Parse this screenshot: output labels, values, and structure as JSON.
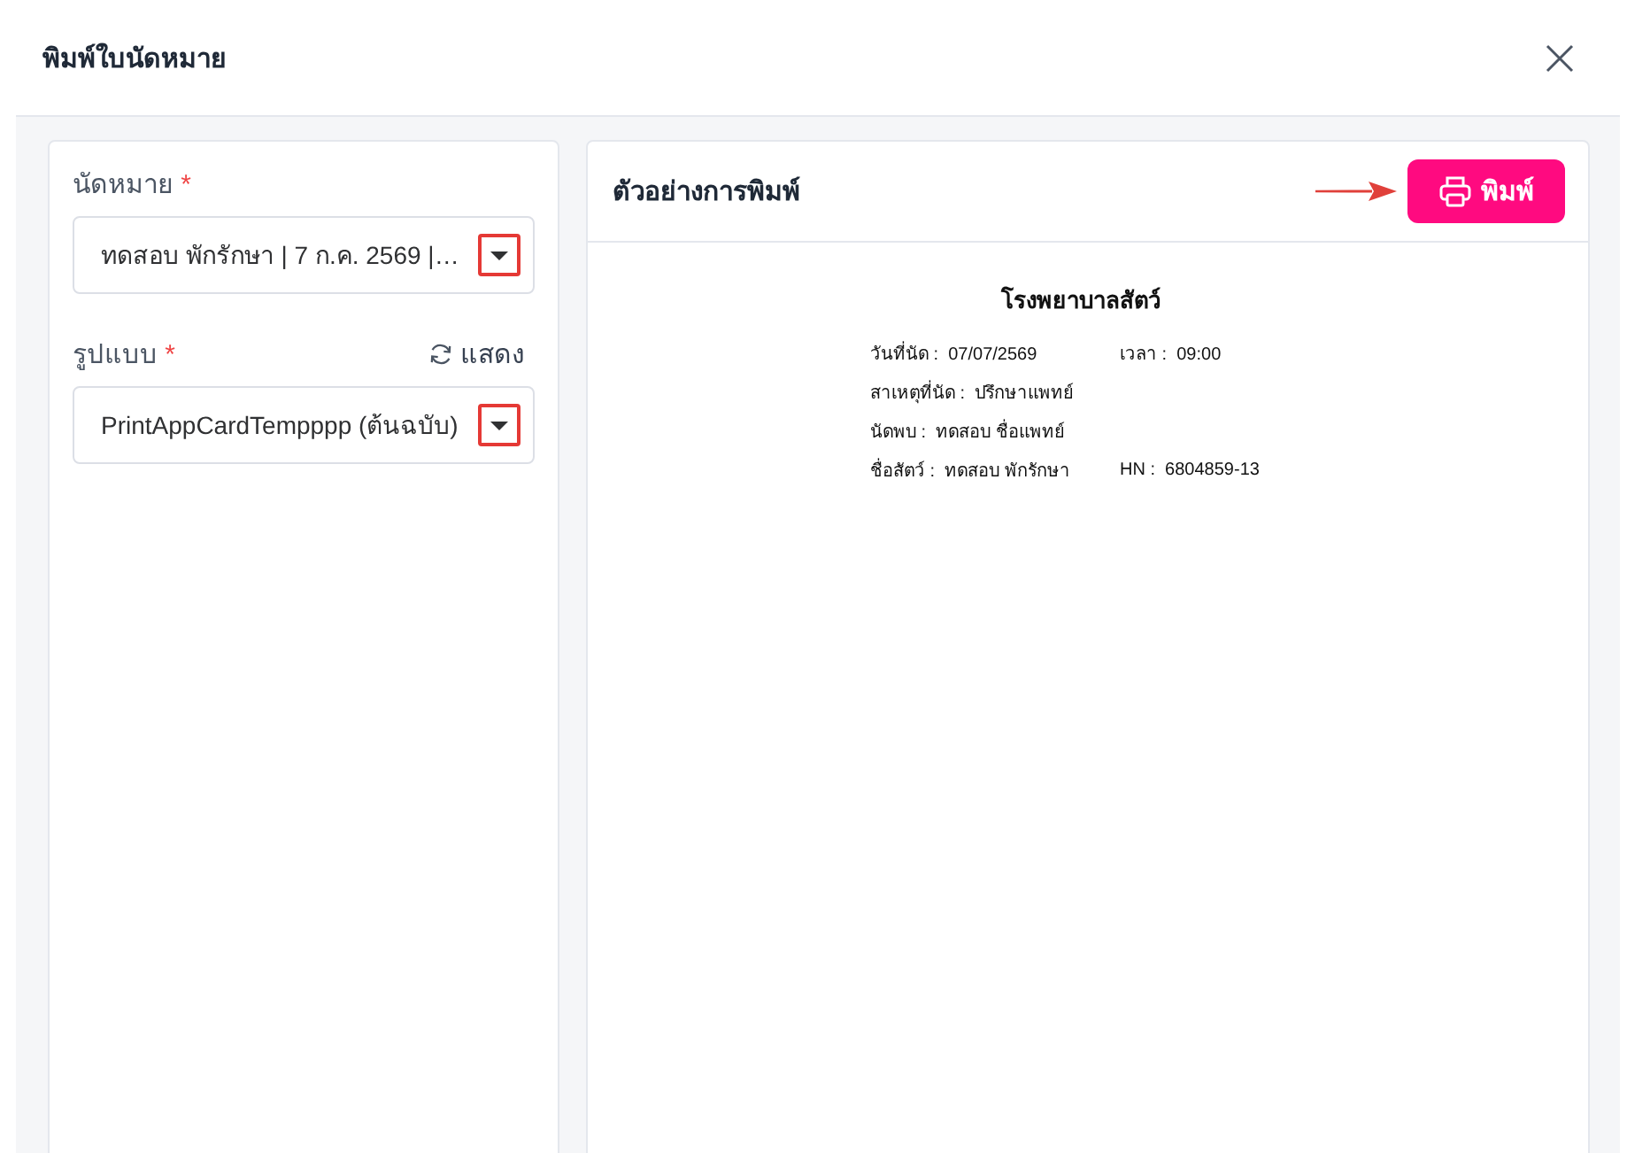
{
  "dialog": {
    "title": "พิมพ์ใบนัดหมาย"
  },
  "form": {
    "fields": [
      {
        "label": "นัดหมาย",
        "required_mark": "*",
        "value": "ทดสอบ พักรักษา | 7 ก.ค. 2569 |…",
        "highlighted": true
      },
      {
        "label": "รูปแบบ",
        "required_mark": "*",
        "action": "แสดง",
        "value": "PrintAppCardTempppp (ต้นฉบับ)",
        "highlighted": true
      }
    ]
  },
  "preview": {
    "title": "ตัวอย่างการพิมพ์",
    "print_button": {
      "label": "พิมพ์",
      "arrow_marked": true
    },
    "document": {
      "heading": "โรงพยาบาลสัตว์",
      "rows": [
        [
          "วันที่นัด :  07/07/2569",
          "เวลา :  09:00"
        ],
        [
          "สาเหตุที่นัด :  ปรึกษาแพทย์"
        ],
        [
          "นัดพบ :  ทดสอบ ชื่อแพทย์"
        ],
        [
          "ชื่อสัตว์ :  ทดสอบ พักรักษา",
          "HN :  6804859-13"
        ]
      ]
    }
  }
}
